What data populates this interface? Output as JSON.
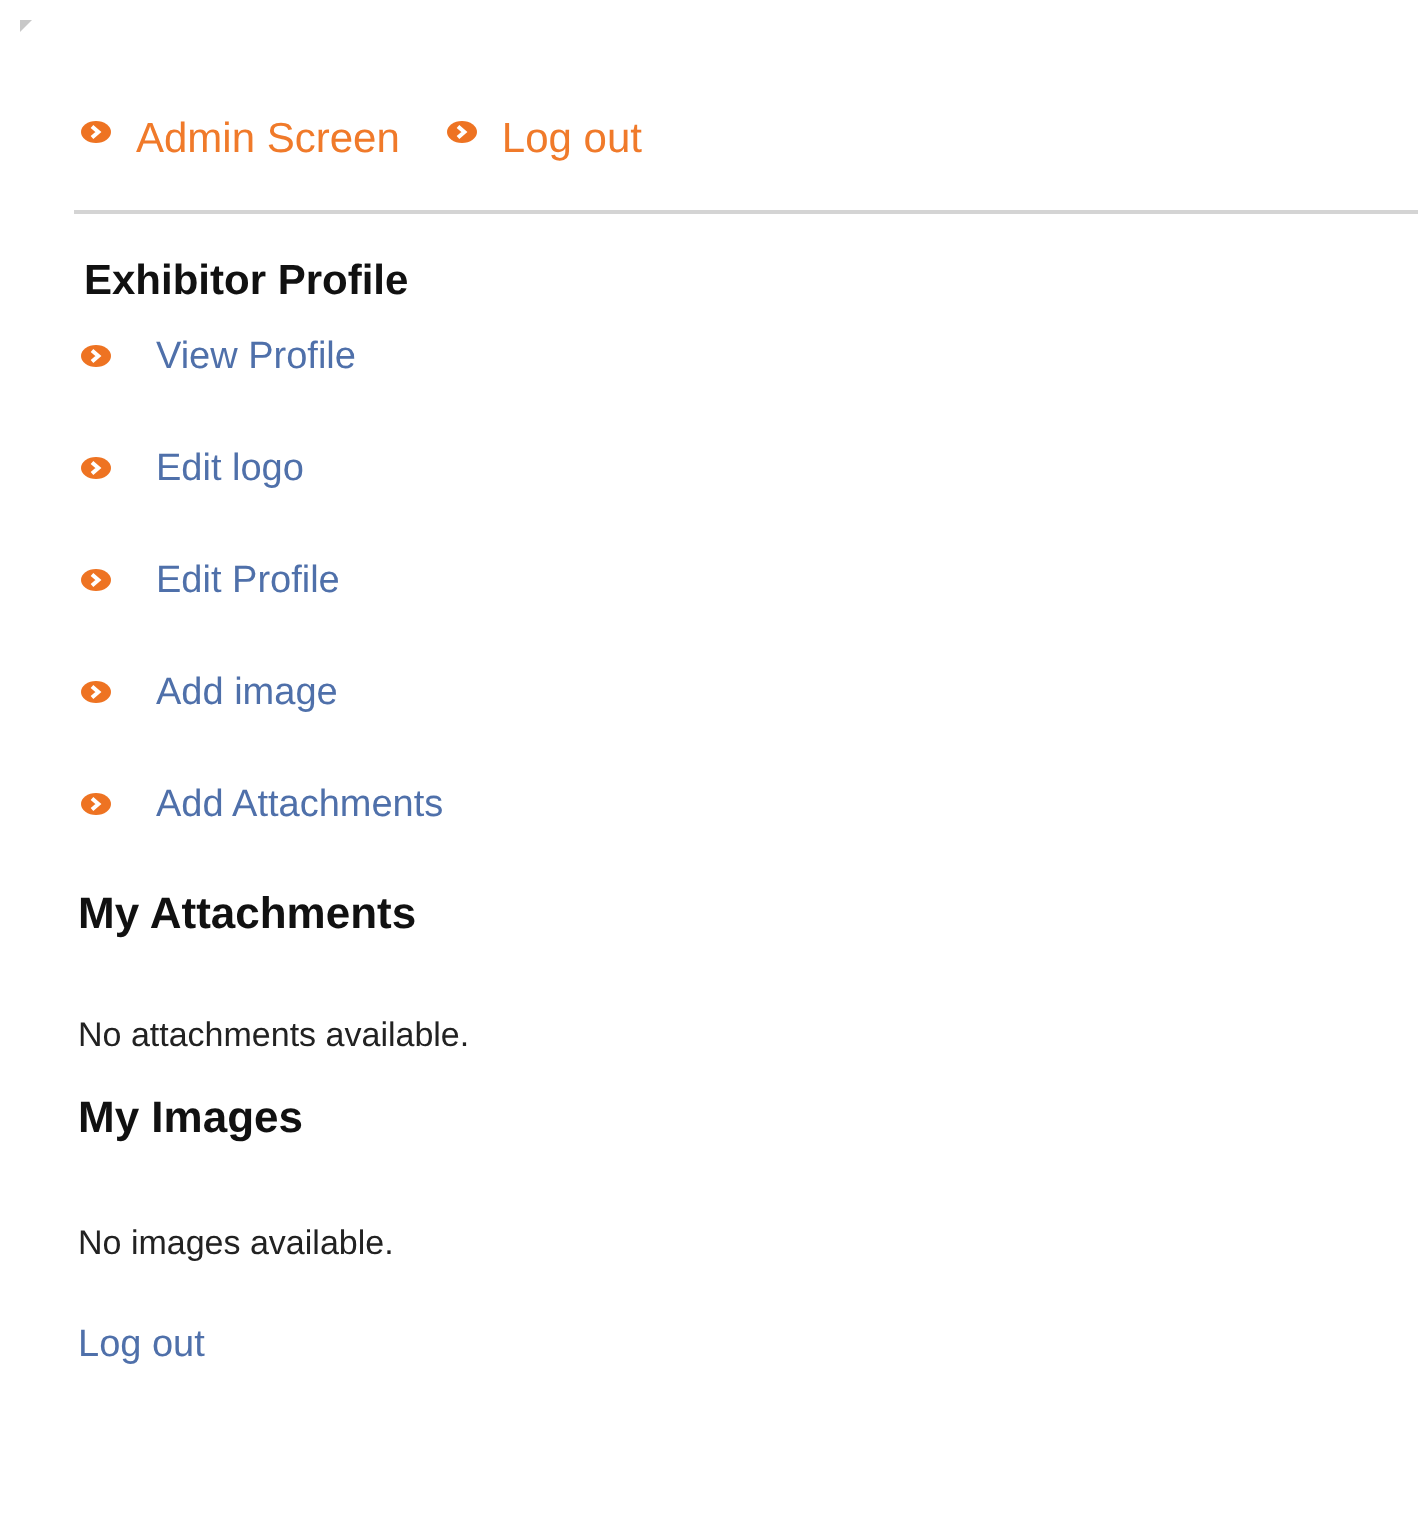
{
  "top_links": [
    {
      "label": "Admin Screen"
    },
    {
      "label": "Log out"
    }
  ],
  "exhibitor_profile": {
    "heading": "Exhibitor Profile",
    "links": [
      {
        "label": "View Profile"
      },
      {
        "label": "Edit logo"
      },
      {
        "label": "Edit Profile"
      },
      {
        "label": "Add image"
      },
      {
        "label": "Add Attachments"
      }
    ]
  },
  "attachments": {
    "heading": "My Attachments",
    "message": "No attachments available."
  },
  "images": {
    "heading": "My Images",
    "message": "No images available."
  },
  "footer_link": "Log out"
}
